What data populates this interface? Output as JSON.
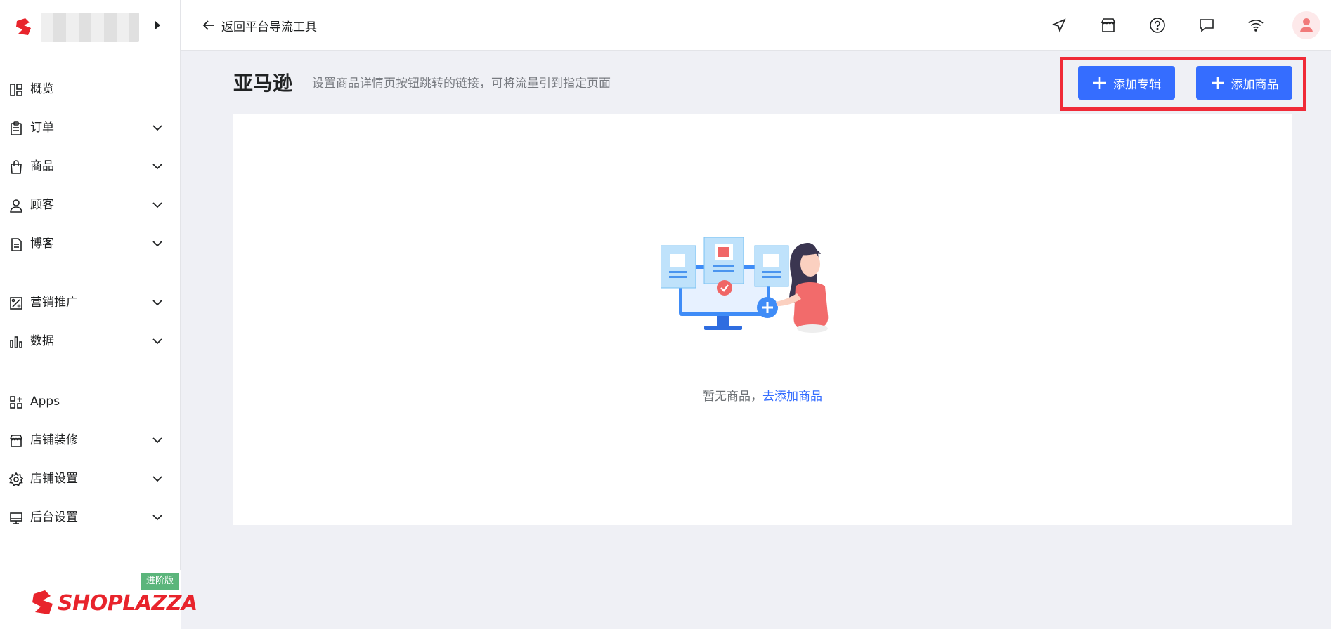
{
  "brand": {
    "name": "SHOPLAZZA",
    "plan_badge": "进阶版",
    "accent": "#e8242c"
  },
  "sidebar": {
    "items": [
      {
        "label": "概览",
        "icon": "dashboard-icon",
        "expandable": false
      },
      {
        "label": "订单",
        "icon": "clipboard-icon",
        "expandable": true
      },
      {
        "label": "商品",
        "icon": "bag-icon",
        "expandable": true
      },
      {
        "label": "顾客",
        "icon": "user-icon",
        "expandable": true
      },
      {
        "label": "博客",
        "icon": "document-icon",
        "expandable": true
      },
      {
        "label": "营销推广",
        "icon": "marketing-icon",
        "expandable": true
      },
      {
        "label": "数据",
        "icon": "bar-chart-icon",
        "expandable": true
      },
      {
        "label": "Apps",
        "icon": "apps-icon",
        "expandable": false
      },
      {
        "label": "店铺装修",
        "icon": "store-icon",
        "expandable": true
      },
      {
        "label": "店铺设置",
        "icon": "gear-icon",
        "expandable": true
      },
      {
        "label": "后台设置",
        "icon": "monitor-icon",
        "expandable": true
      }
    ]
  },
  "topbar": {
    "back_label": "返回平台导流工具",
    "icons": [
      "navigate-icon",
      "storefront-icon",
      "help-icon",
      "chat-icon",
      "wifi-icon",
      "avatar-icon"
    ]
  },
  "page": {
    "title": "亚马逊",
    "description": "设置商品详情页按钮跳转的链接，可将流量引到指定页面",
    "add_collection_label": "添加专辑",
    "add_product_label": "添加商品",
    "primary_color": "#356dff"
  },
  "empty_state": {
    "text": "暂无商品，",
    "link": "去添加商品"
  },
  "annotation": {
    "color": "#f02a37"
  }
}
